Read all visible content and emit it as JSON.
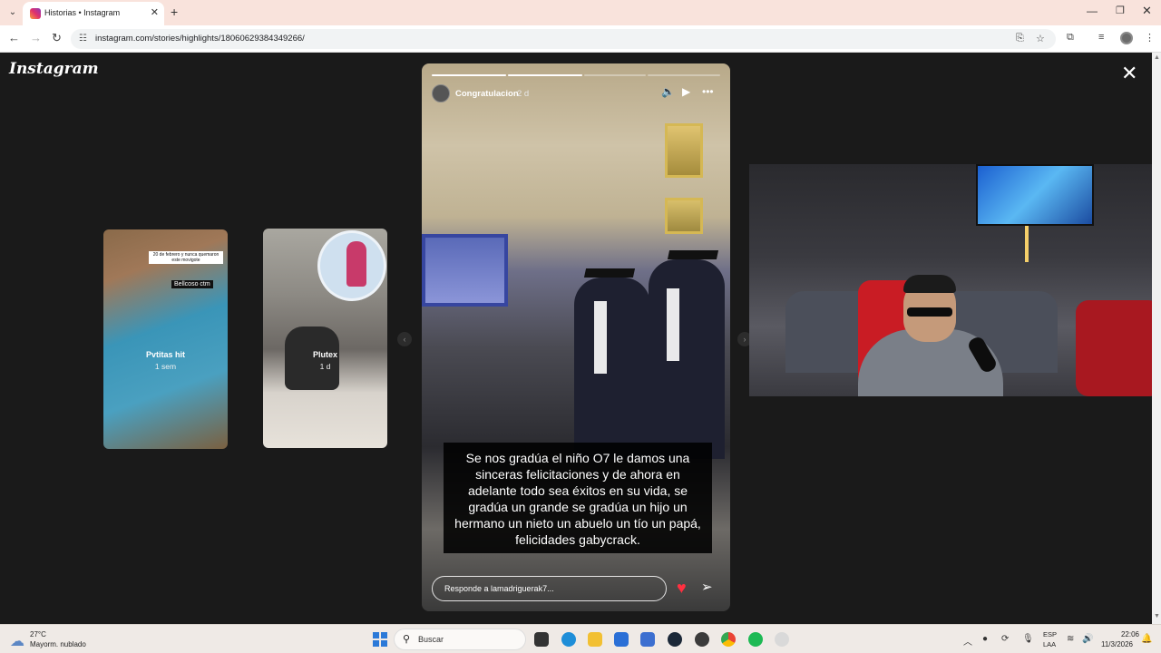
{
  "browser": {
    "tab_title": "Historias • Instagram",
    "url": "instagram.com/stories/highlights/18060629384349266/"
  },
  "instagram": {
    "logo": "Instagram",
    "previews": [
      {
        "name": "Pvtitas hit",
        "time": "1 sem",
        "overlay_text": "20 de febrero y nunca quemaron este movigote",
        "sticker": "Bellcoso ctm"
      },
      {
        "name": "Plutex",
        "time": "1 d"
      }
    ],
    "story": {
      "username": "Congratulacion",
      "time": "2 d",
      "progress": [
        1.0,
        1.0,
        0.0,
        0.0
      ],
      "caption": "Se nos gradúa el niño O7 le damos una sinceras felicitaciones y de ahora en adelante todo sea éxitos en su vida, se gradúa un grande se gradúa un hijo un hermano un nieto un abuelo un tío un papá, felicidades gabycrack.",
      "reply_placeholder": "Responde a lamadriguerak7..."
    }
  },
  "taskbar": {
    "weather_temp": "27°C",
    "weather_desc": "Mayorm. nublado",
    "search_label": "Buscar",
    "lang_line1": "ESP",
    "lang_line2": "LAA",
    "time": "22:06",
    "date": "11/3/2026"
  },
  "colors": {
    "accent_heart": "#ff3040",
    "tab_bar": "#f9e3dc"
  }
}
